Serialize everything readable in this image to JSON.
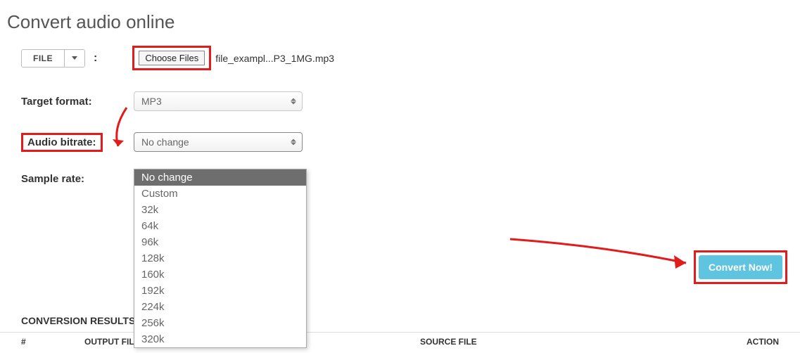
{
  "title": "Convert audio online",
  "file_button": {
    "label": "FILE"
  },
  "choose_files": {
    "label": "Choose Files",
    "filename": "file_exampl...P3_1MG.mp3"
  },
  "labels": {
    "target_format": "Target format:",
    "audio_bitrate": "Audio bitrate:",
    "sample_rate": "Sample rate:",
    "results": "CONVERSION RESULTS:"
  },
  "selects": {
    "target_format": {
      "value": "MP3"
    },
    "audio_bitrate": {
      "value": "No change",
      "options": [
        "No change",
        "Custom",
        "32k",
        "64k",
        "96k",
        "128k",
        "160k",
        "192k",
        "224k",
        "256k",
        "320k"
      ],
      "selected_index": 0
    }
  },
  "convert_button": "Convert Now!",
  "table_headers": {
    "hash": "#",
    "output": "OUTPUT FILE",
    "source": "SOURCE FILE",
    "action": "ACTION"
  }
}
